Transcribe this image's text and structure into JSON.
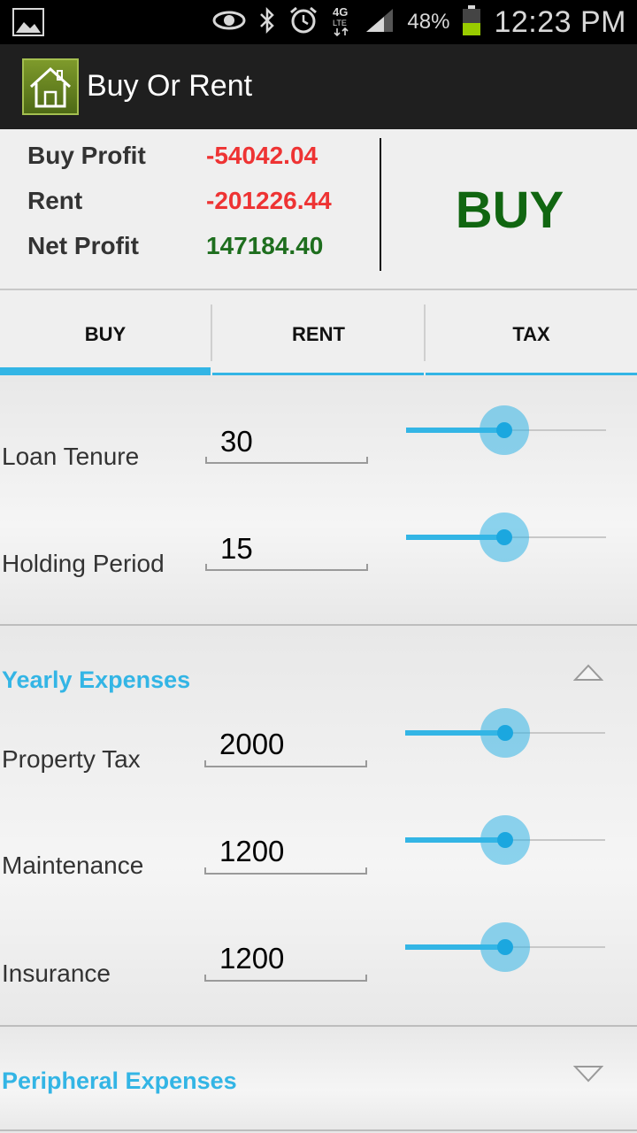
{
  "status_bar": {
    "battery": "48%",
    "network": "4G LTE",
    "time": "12:23 PM",
    "icons": [
      "gallery-icon",
      "eye-icon",
      "bluetooth-icon",
      "alarm-icon",
      "lte-icon",
      "signal-icon",
      "battery-icon"
    ]
  },
  "app": {
    "title": "Buy Or Rent",
    "icon": "house-icon"
  },
  "summary": {
    "buy_profit_label": "Buy Profit",
    "buy_profit_value": "-54042.04",
    "rent_label": "Rent",
    "rent_value": "-201226.44",
    "net_profit_label": "Net Profit",
    "net_profit_value": "147184.40",
    "verdict": "BUY"
  },
  "tabs": [
    {
      "label": "BUY",
      "active": true
    },
    {
      "label": "RENT",
      "active": false
    },
    {
      "label": "TAX",
      "active": false
    }
  ],
  "buy_fields": [
    {
      "label": "Loan Tenure",
      "value": "30",
      "slider_fraction": 0.49
    },
    {
      "label": "Holding Period",
      "value": "15",
      "slider_fraction": 0.49
    }
  ],
  "yearly_expenses": {
    "title": "Yearly Expenses",
    "expanded": true,
    "fields": [
      {
        "label": "Property Tax",
        "value": "2000",
        "slider_fraction": 0.5
      },
      {
        "label": "Maintenance",
        "value": "1200",
        "slider_fraction": 0.5
      },
      {
        "label": "Insurance",
        "value": "1200",
        "slider_fraction": 0.5
      }
    ]
  },
  "peripheral_expenses": {
    "title": "Peripheral Expenses",
    "expanded": false
  },
  "colors": {
    "accent": "#33b5e5",
    "negative": "#ee3333",
    "positive": "#1e6e1e",
    "verdict": "#116611"
  }
}
